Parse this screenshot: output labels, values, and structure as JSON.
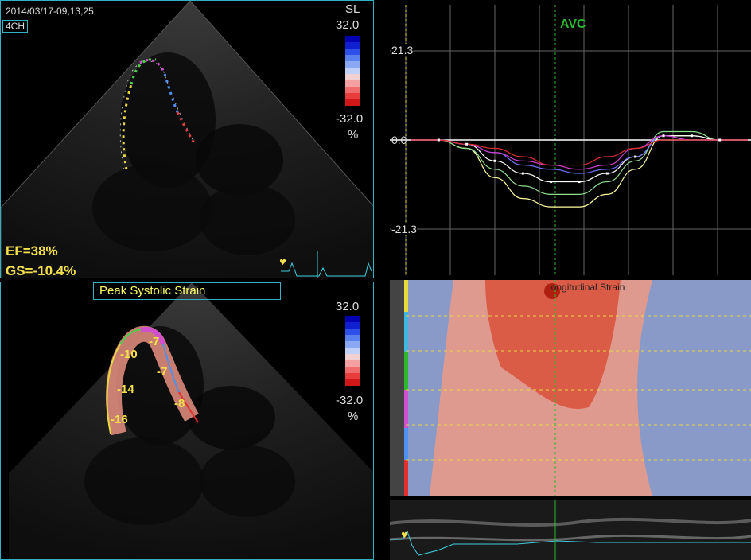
{
  "top_left": {
    "timestamp": "2014/03/17-09,13,25",
    "view_badge": "4CH",
    "mode": "SL",
    "scale_max": "32.0",
    "scale_min": "-32.0",
    "unit": "%",
    "ef": "EF=38%",
    "gs": "GS=-10.4%"
  },
  "bottom_left": {
    "title": "Peak Systolic Strain",
    "scale_max": "32.0",
    "scale_min": "-32.0",
    "unit": "%",
    "segment_values": [
      "-7",
      "-10",
      "-7",
      "-14",
      "-8",
      "-16"
    ]
  },
  "top_right": {
    "marker": "AVC",
    "y_max_label": "21.3",
    "zero_label": "0.0",
    "y_min_label": "-21.3"
  },
  "middle_right": {
    "title": "Longitudinal Strain"
  },
  "colors": {
    "border": "#2fb3c4",
    "text_yellow": "#f4e04d",
    "avc_green": "#2eb82e",
    "title_yellow": "#ffff66"
  },
  "chart_data": {
    "type": "line",
    "ylim": [
      -21.3,
      21.3
    ],
    "x": [
      0,
      1,
      2,
      3,
      4,
      5,
      6,
      7,
      8,
      9,
      10,
      11,
      12
    ],
    "series": [
      {
        "color": "#ffffa0",
        "values": [
          0,
          0,
          -2,
          -9,
          -14,
          -16,
          -16,
          -13,
          -7,
          1,
          1,
          0,
          0
        ]
      },
      {
        "color": "#8fdf8f",
        "values": [
          0,
          0,
          -2,
          -7,
          -11,
          -13,
          -13,
          -10,
          -5,
          2,
          2,
          0,
          0
        ]
      },
      {
        "color": "#ffffff",
        "values": [
          0,
          0,
          -1,
          -5,
          -8,
          -10,
          -10,
          -8,
          -4,
          1,
          1,
          0,
          0
        ]
      },
      {
        "color": "#7070ff",
        "values": [
          0,
          0,
          -1,
          -3,
          -6,
          -7,
          -8,
          -7,
          -4,
          1,
          0,
          0,
          0
        ]
      },
      {
        "color": "#d040d0",
        "values": [
          0,
          0,
          -1,
          -3,
          -5,
          -6,
          -7,
          -6,
          -2,
          1,
          0,
          0,
          0
        ]
      },
      {
        "color": "#e03030",
        "values": [
          0,
          0,
          -1,
          -2,
          -4,
          -6,
          -6,
          -4,
          -2,
          0,
          0,
          0,
          0
        ]
      }
    ]
  }
}
